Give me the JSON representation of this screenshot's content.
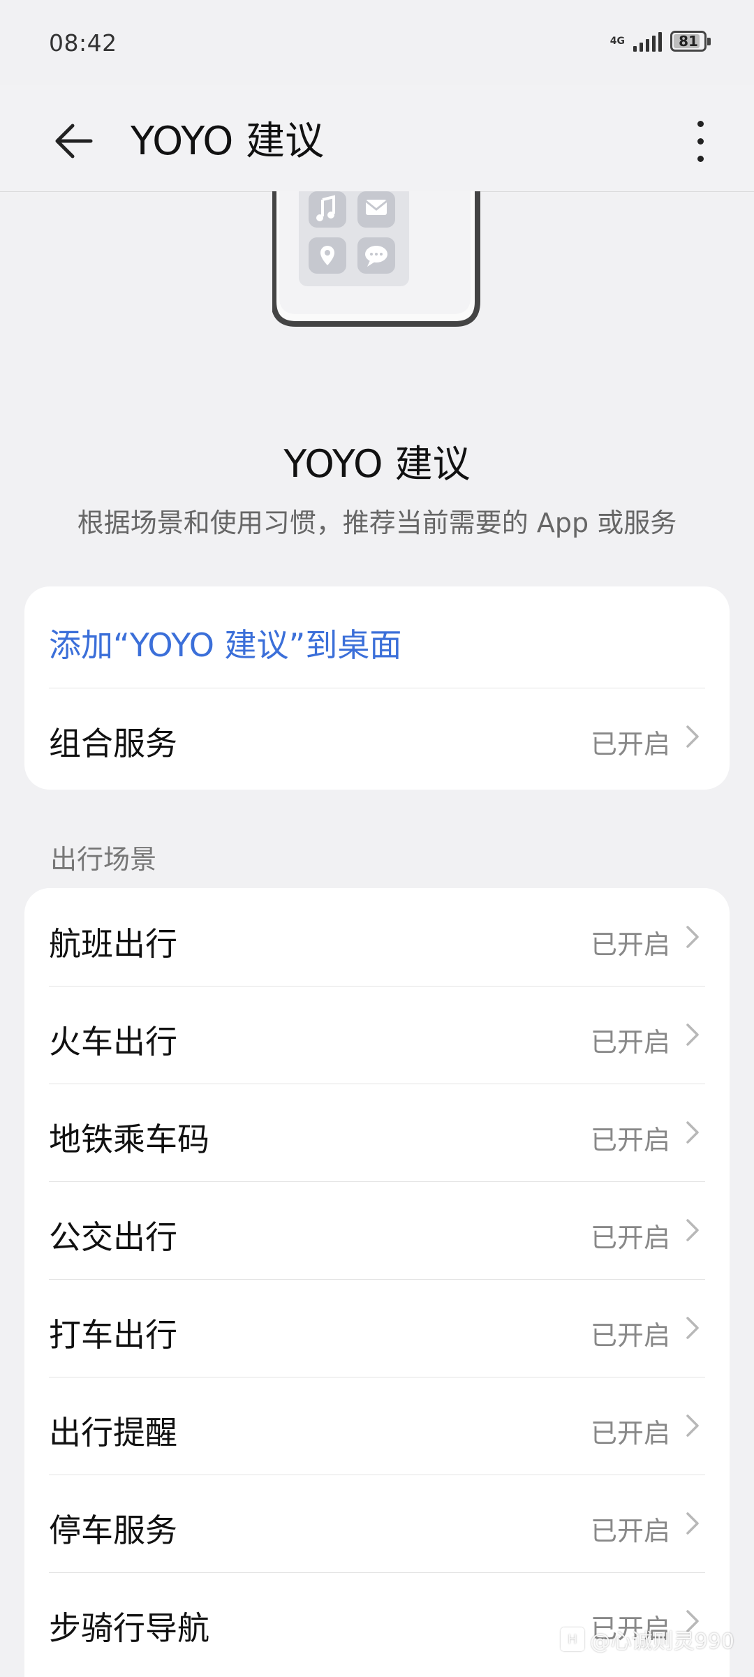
{
  "status_bar": {
    "time": "08:42",
    "network": "4G",
    "battery": "81"
  },
  "header": {
    "title": "YOYO 建议"
  },
  "intro": {
    "title": "YOYO 建议",
    "description": "根据场景和使用习惯，推荐当前需要的 App 或服务"
  },
  "top_card": {
    "add_link": "添加“YOYO 建议”到桌面",
    "combo_label": "组合服务",
    "combo_status": "已开启"
  },
  "travel_section": {
    "title": "出行场景",
    "items": [
      {
        "label": "航班出行",
        "status": "已开启"
      },
      {
        "label": "火车出行",
        "status": "已开启"
      },
      {
        "label": "地铁乘车码",
        "status": "已开启"
      },
      {
        "label": "公交出行",
        "status": "已开启"
      },
      {
        "label": "打车出行",
        "status": "已开启"
      },
      {
        "label": "出行提醒",
        "status": "已开启"
      },
      {
        "label": "停车服务",
        "status": "已开启"
      },
      {
        "label": "步骑行导航",
        "status": "已开启"
      }
    ]
  },
  "watermark": {
    "badge": "H",
    "text": "@心诚则灵990"
  },
  "colors": {
    "accent": "#3b6fd9",
    "background": "#f1f1f3",
    "card": "#ffffff"
  }
}
